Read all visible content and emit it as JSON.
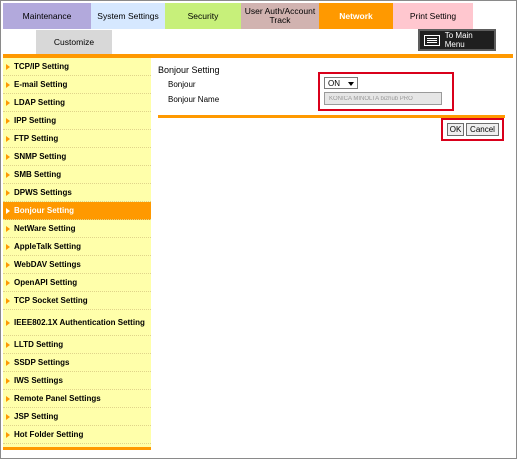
{
  "tabs": [
    {
      "label": "Maintenance"
    },
    {
      "label": "System Settings"
    },
    {
      "label": "Security"
    },
    {
      "label": "User Auth/Account Track"
    },
    {
      "label": "Network"
    },
    {
      "label": "Print Setting"
    }
  ],
  "customize_tab": {
    "label": "Customize"
  },
  "main_menu": {
    "label": "To Main Menu",
    "icon": "menu-list-icon"
  },
  "sidebar": {
    "items": [
      {
        "label": "TCP/IP Setting"
      },
      {
        "label": "E-mail Setting"
      },
      {
        "label": "LDAP Setting"
      },
      {
        "label": "IPP Setting"
      },
      {
        "label": "FTP Setting"
      },
      {
        "label": "SNMP Setting"
      },
      {
        "label": "SMB Setting"
      },
      {
        "label": "DPWS Settings"
      },
      {
        "label": "Bonjour Setting"
      },
      {
        "label": "NetWare Setting"
      },
      {
        "label": "AppleTalk Setting"
      },
      {
        "label": "WebDAV Settings"
      },
      {
        "label": "OpenAPI Setting"
      },
      {
        "label": "TCP Socket Setting"
      },
      {
        "label": "IEEE802.1X Authentication Setting"
      },
      {
        "label": "LLTD Setting"
      },
      {
        "label": "SSDP Settings"
      },
      {
        "label": "IWS Settings"
      },
      {
        "label": "Remote Panel Settings"
      },
      {
        "label": "JSP Setting"
      },
      {
        "label": "Hot Folder Setting"
      }
    ],
    "active_item": "Bonjour Setting"
  },
  "content": {
    "title": "Bonjour Setting",
    "bonjour_label": "Bonjour",
    "bonjour_value": "ON",
    "bonjour_name_label": "Bonjour Name",
    "bonjour_name_value": "KONICA MINOLTA bizhub PRO"
  },
  "buttons": {
    "ok": "OK",
    "cancel": "Cancel"
  },
  "colors": {
    "accent": "#ff9900",
    "sidebar_bg": "#ffffaa",
    "highlight": "#d9001b"
  }
}
